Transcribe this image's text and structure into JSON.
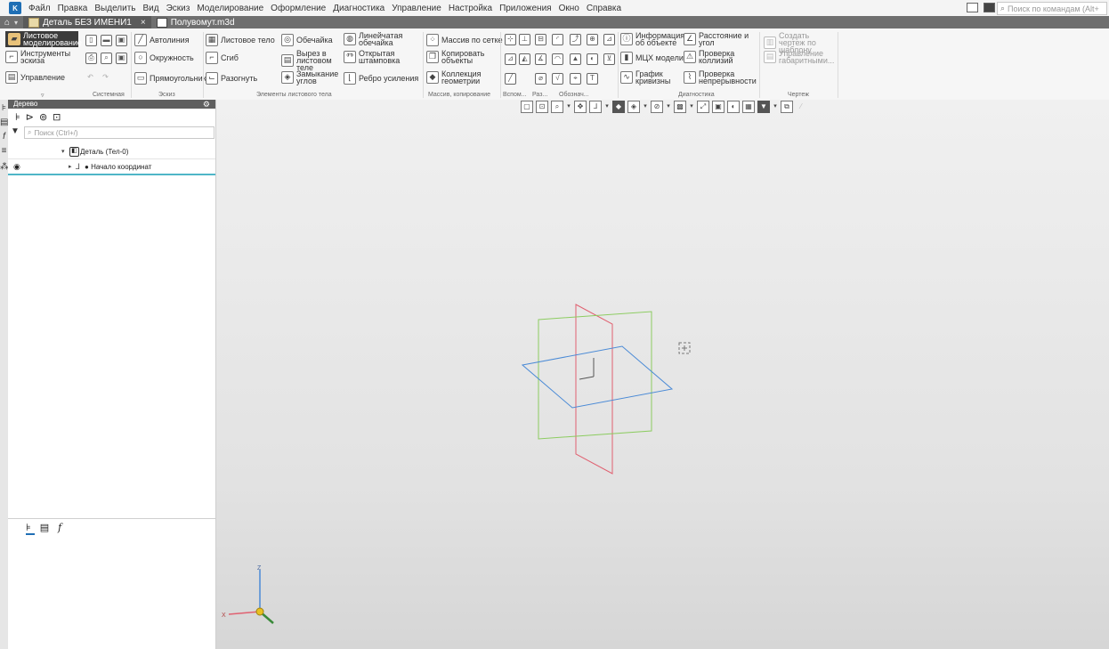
{
  "menu": {
    "items": [
      "Файл",
      "Правка",
      "Выделить",
      "Вид",
      "Эскиз",
      "Моделирование",
      "Оформление",
      "Диагностика",
      "Управление",
      "Настройка",
      "Приложения",
      "Окно",
      "Справка"
    ],
    "search_placeholder": "Поиск по командам (Alt+"
  },
  "tabs": [
    {
      "label": "Деталь БЕЗ ИМЕНИ1",
      "close": "×"
    },
    {
      "label": "Полувомут.m3d"
    }
  ],
  "ribbon": {
    "modes": [
      "Листовое моделирование",
      "Инструменты эскиза",
      "Управление"
    ],
    "system": {
      "label": "Системная"
    },
    "sketch": {
      "items": [
        "Автолиния",
        "Окружность",
        "Прямоугольник"
      ],
      "label": "Эскиз"
    },
    "sheet": {
      "items": [
        "Листовое тело",
        "Сгиб",
        "Разогнуть",
        "Обечайка",
        "Вырез в листовом теле",
        "Замыкание углов",
        "Линейчатая обечайка",
        "Открытая штамповка",
        "Ребро усиления"
      ],
      "label": "Элементы листового тела"
    },
    "array": {
      "items": [
        "Массив по сетке",
        "Копировать объекты",
        "Коллекция геометрии"
      ],
      "label": "Массив, копирование"
    },
    "aux": {
      "labels": [
        "Вспом...",
        "Раз...",
        "Обознач..."
      ]
    },
    "diag": {
      "items": [
        "Информация об объекте",
        "Расстояние и угол",
        "МЦХ модели",
        "Проверка коллизий",
        "График кривизны",
        "Проверка непрерывности"
      ],
      "label": "Диагностика"
    },
    "drawing": {
      "items": [
        "Создать чертеж по шаблону",
        "Управление габаритными..."
      ],
      "label": "Чертеж"
    }
  },
  "tree": {
    "title": "Дерево",
    "search_placeholder": "Поиск (Ctrl+/)",
    "root": "Деталь (Тел-0)",
    "child": "Начало координат"
  },
  "axes": {
    "x": "X",
    "z": "Z"
  },
  "colors": {
    "menu_bg": "#f4f4f4",
    "tab_bar": "#6f6f6f",
    "panel_header": "#5f5f5f",
    "selection": "#4fb6c7",
    "plane_xy": "#4a8ad6",
    "plane_xz": "#e06070",
    "plane_yz": "#8ccc60"
  }
}
